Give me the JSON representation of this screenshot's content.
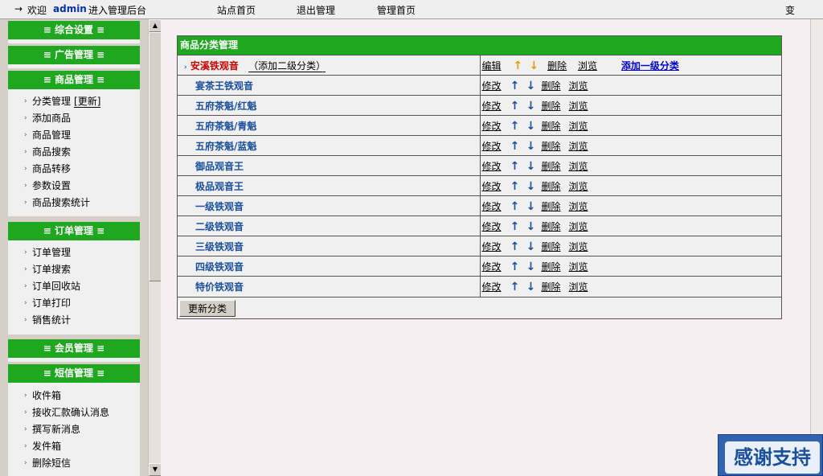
{
  "topbar": {
    "arrow": "→",
    "welcome": "欢迎",
    "user": "admin",
    "enter": "进入管理后台",
    "nav": [
      "站点首页",
      "退出管理",
      "管理首页"
    ],
    "right": "变"
  },
  "sidebar": {
    "menus": [
      {
        "title": "≡ 综合设置 ≡",
        "items": []
      },
      {
        "title": "≡ 广告管理 ≡",
        "items": []
      },
      {
        "title": "≡ 商品管理 ≡",
        "items": [
          {
            "label": "分类管理",
            "extra": "[更新]"
          },
          {
            "label": "添加商品"
          },
          {
            "label": "商品管理"
          },
          {
            "label": "商品搜索"
          },
          {
            "label": "商品转移"
          },
          {
            "label": "参数设置"
          },
          {
            "label": "商品搜索统计"
          }
        ]
      },
      {
        "title": "≡ 订单管理 ≡",
        "items": [
          {
            "label": "订单管理"
          },
          {
            "label": "订单搜索"
          },
          {
            "label": "订单回收站"
          },
          {
            "label": "订单打印"
          },
          {
            "label": "销售统计"
          }
        ]
      },
      {
        "title": "≡ 会员管理 ≡",
        "items": []
      },
      {
        "title": "≡ 短信管理 ≡",
        "items": [
          {
            "label": "收件箱"
          },
          {
            "label": "接收汇款确认消息"
          },
          {
            "label": "撰写新消息"
          },
          {
            "label": "发件箱"
          },
          {
            "label": "删除短信"
          }
        ]
      }
    ]
  },
  "panel": {
    "title": "商品分类管理",
    "top_category": {
      "name": "安溪铁观音",
      "add_sub": "（添加二级分类）",
      "edit": "编辑",
      "delete": "删除",
      "browse": "浏览",
      "add_top": "添加一级分类"
    },
    "sub_ops": {
      "edit": "修改",
      "delete": "删除",
      "browse": "浏览"
    },
    "subcategories": [
      "宴茶王铁观音",
      "五府茶魁/红魁",
      "五府茶魁/青魁",
      "五府茶魁/蓝魁",
      "御品观音王",
      "极品观音王",
      "一级铁观音",
      "二级铁观音",
      "三级铁观音",
      "四级铁观音",
      "特价铁观音"
    ],
    "update_button": "更新分类"
  },
  "badge": {
    "text": "感谢支持"
  },
  "colors": {
    "menu_green": "#1fa81f",
    "link_blue": "#1a4f9c",
    "accent_red": "#cc0000",
    "arrow_orange": "#e69a12"
  }
}
